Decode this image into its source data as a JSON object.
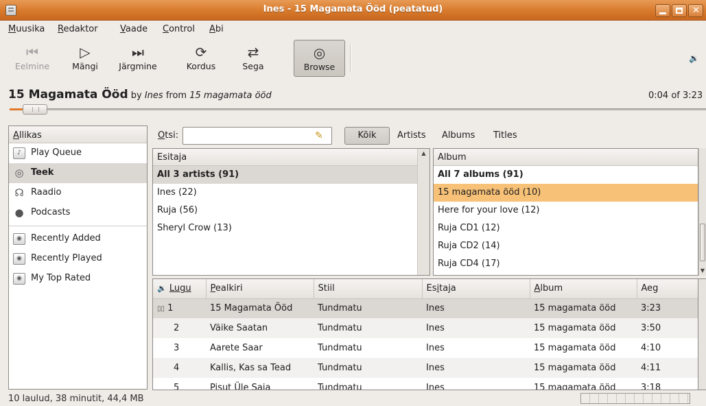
{
  "window": {
    "title": "Ines - 15 Magamata Ööd (peatatud)"
  },
  "menubar": {
    "items": [
      {
        "mnemonic": "M",
        "rest": "uusika"
      },
      {
        "mnemonic": "R",
        "rest": "edaktor"
      },
      {
        "mnemonic": "V",
        "rest": "aade"
      },
      {
        "mnemonic": "C",
        "rest": "ontrol"
      },
      {
        "mnemonic": "A",
        "rest": "bi"
      }
    ]
  },
  "toolbar": {
    "previous_label": "Eelmine",
    "play_label": "Mängi",
    "next_label": "Järgmine",
    "repeat_label": "Kordus",
    "shuffle_label": "Sega",
    "browse_label": "Browse"
  },
  "now_playing": {
    "song": "15 Magamata Ööd",
    "by": "by",
    "artist": "Ines",
    "from": "from",
    "album": "15 magamata ööd",
    "time": "0:04 of 3:23",
    "progress_fraction": 0.02
  },
  "sources": {
    "header_mnemonic": "A",
    "header_rest": "llikas",
    "items": [
      {
        "label": "Play Queue",
        "icon": "play-queue-icon"
      },
      {
        "label": "Teek",
        "icon": "library-icon",
        "selected": true
      },
      {
        "label": "Raadio",
        "icon": "radio-icon"
      },
      {
        "label": "Podcasts",
        "icon": "podcast-icon"
      }
    ],
    "playlists": [
      {
        "label": "Recently Added",
        "icon": "smart-playlist-icon"
      },
      {
        "label": "Recently Played",
        "icon": "smart-playlist-icon"
      },
      {
        "label": "My Top Rated",
        "icon": "smart-playlist-icon"
      }
    ]
  },
  "search": {
    "label_mnemonic": "O",
    "label_rest": "tsi:",
    "value": "",
    "filters": {
      "all": "Kõik",
      "artists": "Artists",
      "albums": "Albums",
      "titles": "Titles"
    }
  },
  "artist_browser": {
    "header": "Esitaja",
    "rows": [
      "All 3 artists (91)",
      "Ines (22)",
      "Ruja (56)",
      "Sheryl Crow (13)"
    ]
  },
  "album_browser": {
    "header": "Album",
    "rows": [
      "All 7 albums (91)",
      "15 magamata ööd (10)",
      "Here for your love (12)",
      "Ruja CD1 (12)",
      "Ruja CD2 (14)",
      "Ruja CD4 (17)"
    ]
  },
  "tracks": {
    "headers": {
      "track_mnemonic": "",
      "track": "Lugu",
      "title_mnemonic": "P",
      "title_rest": "ealkiri",
      "genre": "Stiil",
      "artist_pre": "Es",
      "artist_mnemonic": "i",
      "artist_post": "taja",
      "album_mnemonic": "A",
      "album_rest": "lbum",
      "time": "Aeg"
    },
    "rows": [
      {
        "num": "1",
        "title": "15 Magamata Ööd",
        "genre": "Tundmatu",
        "artist": "Ines",
        "album": "15 magamata ööd",
        "time": "3:23",
        "playing": true
      },
      {
        "num": "2",
        "title": "Väike Saatan",
        "genre": "Tundmatu",
        "artist": "Ines",
        "album": "15 magamata ööd",
        "time": "3:50"
      },
      {
        "num": "3",
        "title": "Aarete Saar",
        "genre": "Tundmatu",
        "artist": "Ines",
        "album": "15 magamata ööd",
        "time": "4:10"
      },
      {
        "num": "4",
        "title": "Kallis, Kas sa Tead",
        "genre": "Tundmatu",
        "artist": "Ines",
        "album": "15 magamata ööd",
        "time": "4:11"
      },
      {
        "num": "5",
        "title": "Pisut Üle Saja",
        "genre": "Tundmatu",
        "artist": "Ines",
        "album": "15 magamata ööd",
        "time": "3:18"
      }
    ]
  },
  "statusbar": {
    "text": "10 laulud, 38 minutit, 44,4 MB"
  }
}
